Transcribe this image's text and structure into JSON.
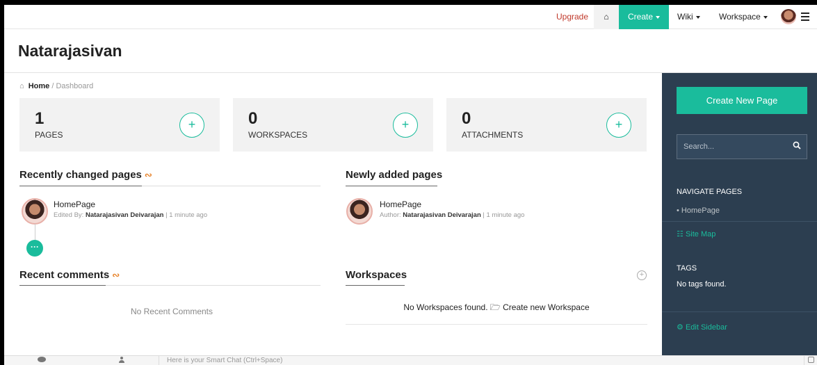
{
  "nav": {
    "upgrade": "Upgrade",
    "create": "Create",
    "wiki": "Wiki",
    "workspace": "Workspace",
    "home_icon": "home-icon",
    "menu_icon": "hamburger-menu-icon"
  },
  "page": {
    "title": "Natarajasivan"
  },
  "breadcrumb": {
    "home": "Home",
    "separator": "/",
    "current": "Dashboard"
  },
  "stats": [
    {
      "value": "1",
      "label": "PAGES"
    },
    {
      "value": "0",
      "label": "WORKSPACES"
    },
    {
      "value": "0",
      "label": "ATTACHMENTS"
    }
  ],
  "recently_changed": {
    "title": "Recently changed pages",
    "items": [
      {
        "title": "HomePage",
        "meta_prefix": "Edited By:",
        "author": "Natarajasivan Deivarajan",
        "time": "1 minute ago"
      }
    ]
  },
  "newly_added": {
    "title": "Newly added pages",
    "items": [
      {
        "title": "HomePage",
        "meta_prefix": "Author:",
        "author": "Natarajasivan Deivarajan",
        "time": "1 minute ago"
      }
    ]
  },
  "recent_comments": {
    "title": "Recent comments",
    "empty": "No Recent Comments"
  },
  "workspaces": {
    "title": "Workspaces",
    "empty": "No Workspaces found.",
    "create_link": "Create new Workspace"
  },
  "sidebar": {
    "create_button": "Create New Page",
    "search_placeholder": "Search...",
    "navigate_heading": "NAVIGATE PAGES",
    "pages": [
      "HomePage"
    ],
    "site_map": "Site Map",
    "tags_heading": "TAGS",
    "tags_empty": "No tags found.",
    "edit_sidebar": "Edit Sidebar"
  },
  "bottom": {
    "chat_placeholder": "Here is your Smart Chat (Ctrl+Space)"
  },
  "colors": {
    "accent": "#1abc9c",
    "sidebar_bg": "#2c3e50",
    "upgrade": "#c0392b",
    "rss": "#e67e22"
  }
}
